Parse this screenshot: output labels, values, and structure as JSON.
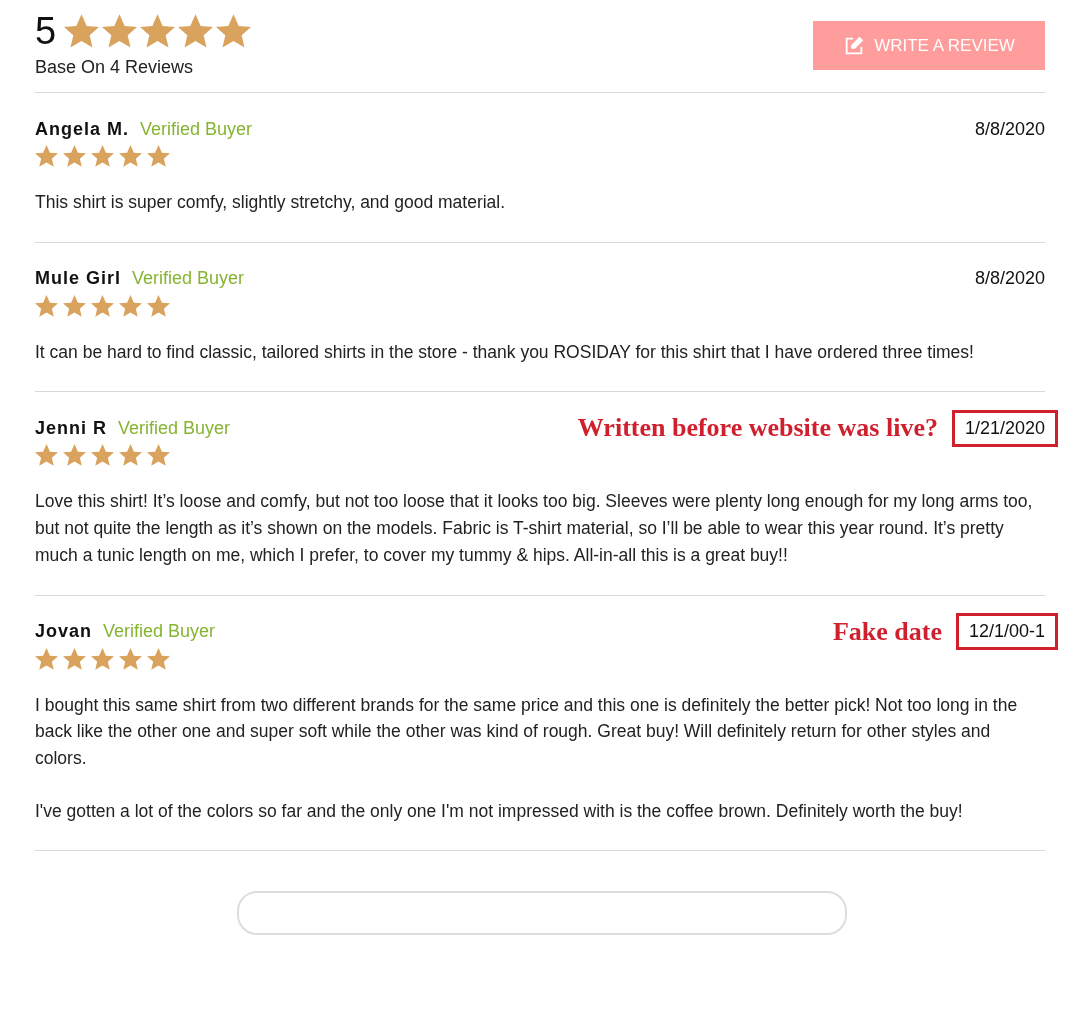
{
  "summary": {
    "score": "5",
    "stars": 5,
    "caption": "Base On 4 Reviews"
  },
  "write_button": {
    "label": "WRITE A REVIEW"
  },
  "reviews": [
    {
      "name": "Angela M.",
      "badge": "Verified Buyer",
      "date": "8/8/2020",
      "flagged": false,
      "stars": 5,
      "body": [
        "This shirt is super comfy, slightly stretchy, and good material."
      ]
    },
    {
      "name": "Mule Girl",
      "badge": "Verified Buyer",
      "date": "8/8/2020",
      "flagged": false,
      "stars": 5,
      "body": [
        "It can be hard to find classic, tailored shirts in the store - thank you ROSIDAY for this shirt that I have ordered three times!"
      ]
    },
    {
      "name": "Jenni R",
      "badge": "Verified Buyer",
      "date": "1/21/2020",
      "flagged": true,
      "annotation": "Written before website was live?",
      "stars": 5,
      "body": [
        "Love this shirt! It’s loose and comfy, but not too loose that it looks too big. Sleeves were plenty long enough for my long arms too, but not quite the length as it’s shown on the models. Fabric is T-shirt material, so I’ll be able to wear this year round. It’s pretty much a tunic length on me, which I prefer, to cover my tummy & hips. All-in-all this is a great buy!!"
      ]
    },
    {
      "name": "Jovan",
      "badge": "Verified Buyer",
      "date": "12/1/00-1",
      "flagged": true,
      "annotation": "Fake date",
      "stars": 5,
      "body": [
        "I bought this same shirt from two different brands for the same price and this one is definitely the better pick! Not too long in the back like the other one and super soft while the other was kind of rough. Great buy! Will definitely return for other styles and colors.",
        "I've gotten a lot of the colors so far and the only one I'm not impressed with is the coffee brown. Definitely worth the buy!"
      ]
    }
  ]
}
